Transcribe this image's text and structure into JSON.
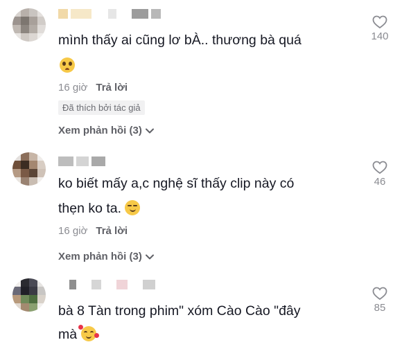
{
  "comments": [
    {
      "text_lines": [
        "mình thấy ai cũng lơ bÀ.. thương bà quá",
        ""
      ],
      "emoji": "pleading-face-emoji",
      "time": "16 giờ",
      "reply_label": "Trả lời",
      "badge": "Đã thích bởi tác giả",
      "view_replies": "Xem phản hồi (3)",
      "likes": "140"
    },
    {
      "text_lines": [
        "ko biết mấy a,c nghệ sĩ thấy clip này có",
        "thẹn ko ta. "
      ],
      "emoji": "smirking-face-emoji",
      "time": "16 giờ",
      "reply_label": "Trả lời",
      "view_replies": "Xem phản hồi (3)",
      "likes": "46"
    },
    {
      "text_lines": [
        "bà 8 Tàn trong phim\" xóm Cào Cào \"đây",
        "mà "
      ],
      "emoji": "smiling-face-with-hearts-emoji",
      "likes": "85"
    }
  ],
  "icons": {
    "heart": "heart-outline-icon",
    "chevron": "chevron-down-icon"
  }
}
